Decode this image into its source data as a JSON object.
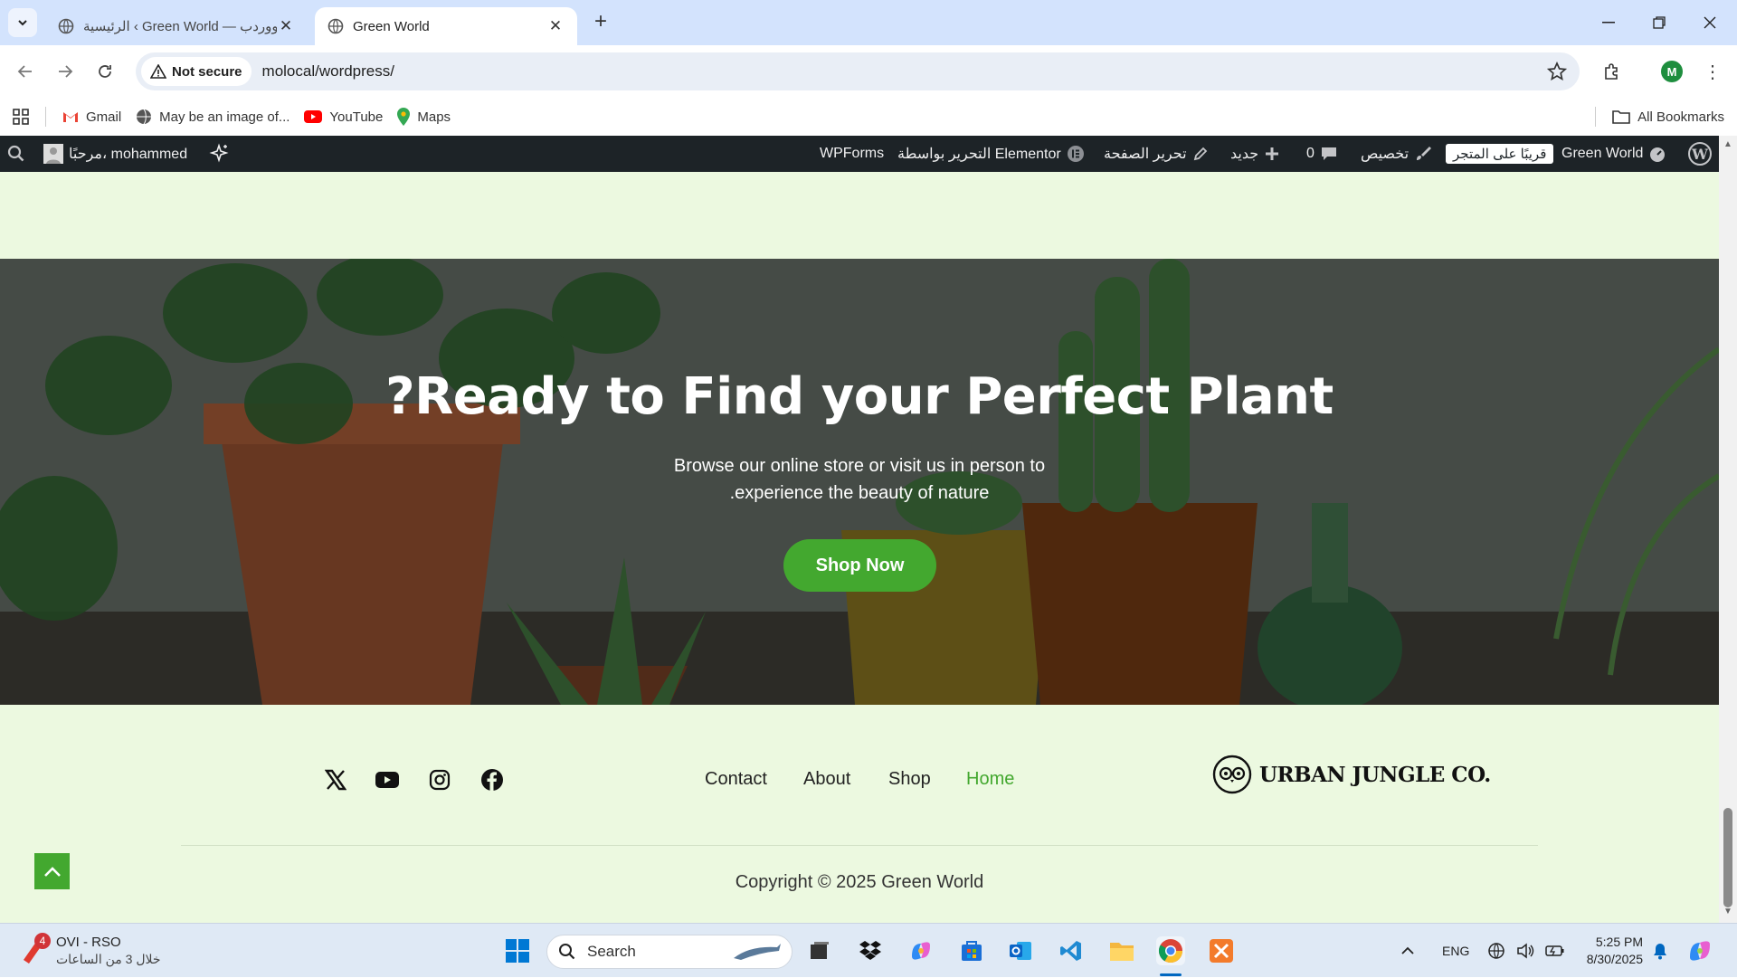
{
  "browser": {
    "tabs": [
      {
        "title": "الرئيسية ‹ Green World — ووردب",
        "active": false
      },
      {
        "title": "Green World",
        "active": true
      }
    ],
    "security_label": "Not secure",
    "url": "molocal/wordpress/",
    "profile_initial": "M",
    "bookmarks": [
      {
        "label": "Gmail",
        "icon": "gmail-icon"
      },
      {
        "label": "May be an image of...",
        "icon": "globe-icon"
      },
      {
        "label": "YouTube",
        "icon": "youtube-icon"
      },
      {
        "label": "Maps",
        "icon": "maps-icon"
      }
    ],
    "all_bookmarks": "All Bookmarks"
  },
  "wp_admin": {
    "site_name": "Green World",
    "coming_soon": "قريبًا على المتجر",
    "customize": "تخصيص",
    "comments_count": "0",
    "new": "جديد",
    "edit_page": "تحرير الصفحة",
    "elementor": "التحرير بواسطة Elementor",
    "wpforms": "WPForms",
    "greeting": "مرحبًا، mohammed"
  },
  "hero": {
    "heading": "?Ready to Find your Perfect Plant",
    "subtext_line1": "Browse our online store or visit us in person to",
    "subtext_line2": ".experience the beauty of nature",
    "cta": "Shop Now"
  },
  "footer": {
    "social": [
      "x-icon",
      "youtube-icon",
      "instagram-icon",
      "facebook-icon"
    ],
    "nav": [
      {
        "label": "Contact",
        "active": false
      },
      {
        "label": "About",
        "active": false
      },
      {
        "label": "Shop",
        "active": false
      },
      {
        "label": "Home",
        "active": true
      }
    ],
    "brand": "URBAN JUNGLE CO.",
    "copyright": "Copyright © 2025 Green World"
  },
  "taskbar": {
    "notification_app": "OVI - RSO",
    "notification_sub": "خلال 3 من الساعات",
    "notification_badge": "4",
    "search_placeholder": "Search",
    "lang": "ENG",
    "time": "5:25 PM",
    "date": "8/30/2025"
  },
  "colors": {
    "accent_green": "#43a82f",
    "page_bg": "#ecf9e0",
    "admin_bar": "#1d2327"
  }
}
